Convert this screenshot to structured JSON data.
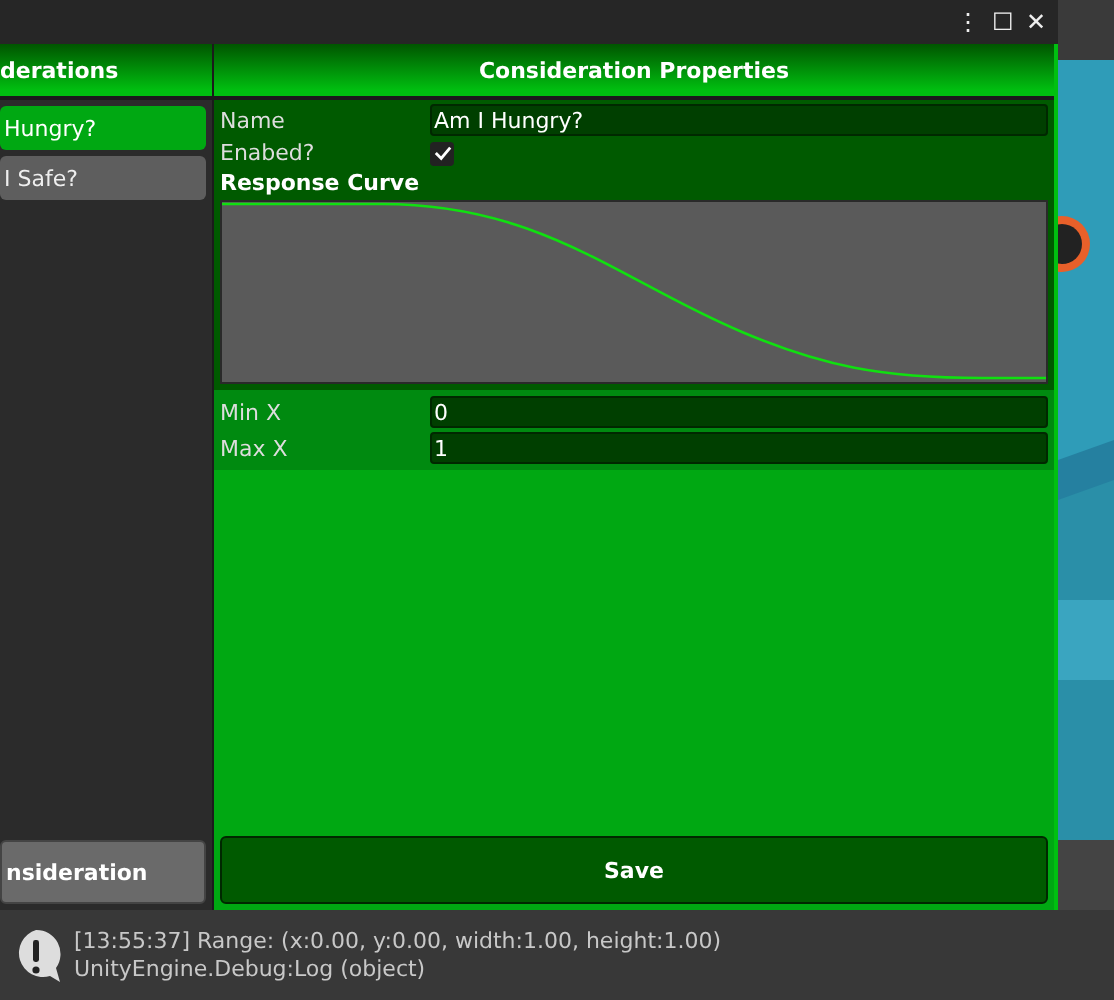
{
  "window": {
    "controls": [
      "⋮",
      "☐",
      "✕"
    ]
  },
  "considerations_panel": {
    "title": "derations",
    "items": [
      {
        "label": "Hungry?",
        "selected": true
      },
      {
        "label": "I Safe?",
        "selected": false
      }
    ],
    "add_button": "nsideration"
  },
  "properties_panel": {
    "title": "Consideration Properties",
    "name_label": "Name",
    "name_value": "Am I Hungry?",
    "enabled_label": "Enabed?",
    "enabled": true,
    "curve_label": "Response Curve",
    "min_label": "Min X",
    "min_value": "0",
    "max_label": "Max X",
    "max_value": "1",
    "save_button": "Save"
  },
  "console": {
    "message": "[13:55:37] Range: (x:0.00, y:0.00, width:1.00, height:1.00)",
    "detail": "UnityEngine.Debug:Log (object)"
  }
}
